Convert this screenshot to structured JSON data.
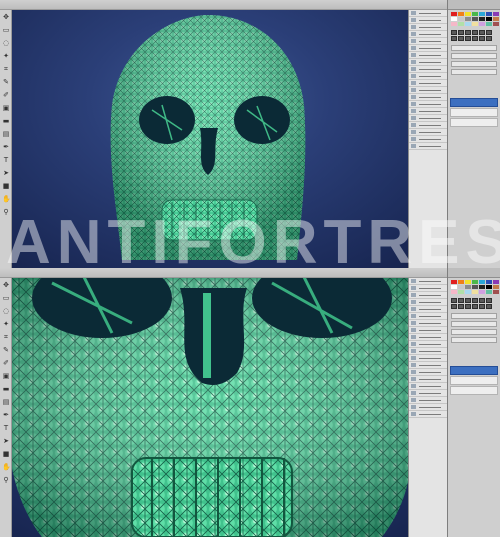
{
  "watermark": {
    "text": "ANTIFORTRESS"
  },
  "toolbox": {
    "tools": [
      {
        "name": "move-tool",
        "glyph": "✥"
      },
      {
        "name": "marquee-tool",
        "glyph": "▭"
      },
      {
        "name": "lasso-tool",
        "glyph": "◌"
      },
      {
        "name": "wand-tool",
        "glyph": "✦"
      },
      {
        "name": "crop-tool",
        "glyph": "⌗"
      },
      {
        "name": "eyedropper-tool",
        "glyph": "✎"
      },
      {
        "name": "brush-tool",
        "glyph": "✐"
      },
      {
        "name": "stamp-tool",
        "glyph": "▣"
      },
      {
        "name": "eraser-tool",
        "glyph": "▬"
      },
      {
        "name": "gradient-tool",
        "glyph": "▤"
      },
      {
        "name": "pen-tool",
        "glyph": "✒"
      },
      {
        "name": "type-tool",
        "glyph": "T"
      },
      {
        "name": "path-select-tool",
        "glyph": "➤"
      },
      {
        "name": "shape-tool",
        "glyph": "■"
      },
      {
        "name": "hand-tool",
        "glyph": "✋"
      },
      {
        "name": "zoom-tool",
        "glyph": "⚲"
      }
    ]
  },
  "colors": {
    "canvas_bg": "#1f3068",
    "skull_fill": "#4fd69d",
    "skull_shade": "#1f8a66",
    "skull_highlight": "#9ff2c6",
    "socket": "#0b2a36"
  },
  "swatches": [
    "#e02020",
    "#f07f18",
    "#f3e22a",
    "#4bb84a",
    "#2aa7d8",
    "#2b4fb6",
    "#8a3ab5",
    "#ffffff",
    "#c8c8c8",
    "#8c8c8c",
    "#555555",
    "#222222",
    "#000000",
    "#c47a4a",
    "#f5b8c8",
    "#b0e0a8",
    "#a8d8f0",
    "#f0e0a0",
    "#d0a0e0",
    "#60c0a0",
    "#a05050"
  ],
  "layers_panel": {
    "entries": 3
  }
}
